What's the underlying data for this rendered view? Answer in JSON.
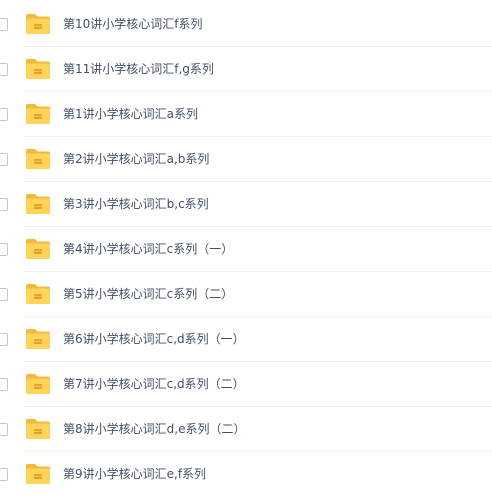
{
  "file_list": {
    "items": [
      {
        "name": "第10讲小学核心词汇f系列",
        "icon": "folder-icon"
      },
      {
        "name": "第11讲小学核心词汇f,g系列",
        "icon": "folder-icon"
      },
      {
        "name": "第1讲小学核心词汇a系列",
        "icon": "folder-icon"
      },
      {
        "name": "第2讲小学核心词汇a,b系列",
        "icon": "folder-icon"
      },
      {
        "name": "第3讲小学核心词汇b,c系列",
        "icon": "folder-icon"
      },
      {
        "name": "第4讲小学核心词汇c系列（一）",
        "icon": "folder-icon"
      },
      {
        "name": "第5讲小学核心词汇c系列（二）",
        "icon": "folder-icon"
      },
      {
        "name": "第6讲小学核心词汇c,d系列（一）",
        "icon": "folder-icon"
      },
      {
        "name": "第7讲小学核心词汇c,d系列（二）",
        "icon": "folder-icon"
      },
      {
        "name": "第8讲小学核心词汇d,e系列（二）",
        "icon": "folder-icon"
      },
      {
        "name": "第9讲小学核心词汇e,f系列",
        "icon": "folder-icon"
      }
    ]
  },
  "colors": {
    "folder_body": "#ffd45a",
    "folder_back": "#f5b93b",
    "folder_label": "#ea9e22",
    "text": "#424e67",
    "divider": "#f1f1f1"
  }
}
